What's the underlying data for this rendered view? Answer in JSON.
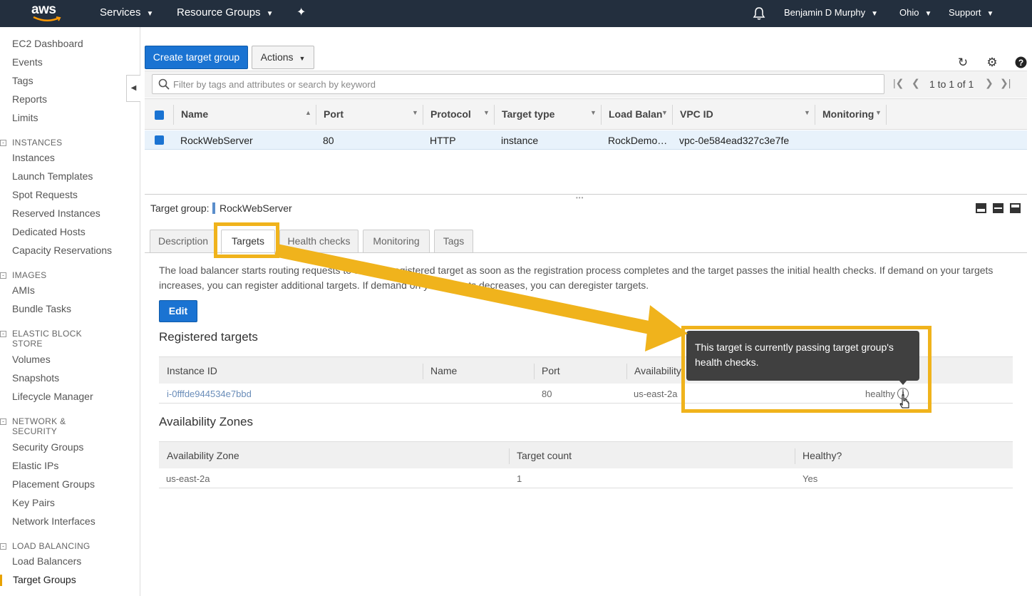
{
  "topbar": {
    "logo_text": "aws",
    "services": "Services",
    "resource_groups": "Resource Groups",
    "user": "Benjamin D Murphy",
    "region": "Ohio",
    "support": "Support"
  },
  "sidebar": {
    "top_links": [
      "EC2 Dashboard",
      "Events",
      "Tags",
      "Reports",
      "Limits"
    ],
    "sections": [
      {
        "title": "INSTANCES",
        "items": [
          "Instances",
          "Launch Templates",
          "Spot Requests",
          "Reserved Instances",
          "Dedicated Hosts",
          "Capacity Reservations"
        ]
      },
      {
        "title": "IMAGES",
        "items": [
          "AMIs",
          "Bundle Tasks"
        ]
      },
      {
        "title_line1": "ELASTIC BLOCK",
        "title_line2": "STORE",
        "items": [
          "Volumes",
          "Snapshots",
          "Lifecycle Manager"
        ]
      },
      {
        "title_line1": "NETWORK &",
        "title_line2": "SECURITY",
        "items": [
          "Security Groups",
          "Elastic IPs",
          "Placement Groups",
          "Key Pairs",
          "Network Interfaces"
        ]
      },
      {
        "title": "LOAD BALANCING",
        "items": [
          "Load Balancers",
          "Target Groups"
        ]
      }
    ],
    "active_item": "Target Groups"
  },
  "toolbar": {
    "create_label": "Create target group",
    "actions_label": "Actions",
    "search_placeholder": "Filter by tags and attributes or search by keyword",
    "pager_text": "1 to 1 of 1"
  },
  "grid": {
    "columns": [
      "Name",
      "Port",
      "Protocol",
      "Target type",
      "Load Balanc",
      "VPC ID",
      "Monitoring"
    ],
    "row": {
      "name": "RockWebServer",
      "port": "80",
      "protocol": "HTTP",
      "target_type": "instance",
      "load_balancer": "RockDemo…",
      "vpc_id": "vpc-0e584ead327c3e7fe",
      "monitoring": ""
    }
  },
  "detail": {
    "label": "Target group:",
    "name": "RockWebServer",
    "tabs": [
      "Description",
      "Targets",
      "Health checks",
      "Monitoring",
      "Tags"
    ],
    "active_tab": "Targets",
    "description": "The load balancer starts routing requests to a newly registered target as soon as the registration process completes and the target passes the initial health checks. If demand on your targets increases, you can register additional targets. If demand on your targets decreases, you can deregister targets.",
    "edit_label": "Edit",
    "registered_title": "Registered targets",
    "registered_columns": [
      "Instance ID",
      "Name",
      "Port",
      "Availability"
    ],
    "registered_row": {
      "instance_id": "i-0fffde944534e7bbd",
      "name": "",
      "port": "80",
      "zone": "us-east-2a",
      "status": "healthy"
    },
    "tooltip": "This target is currently passing target group's health checks.",
    "az_title": "Availability Zones",
    "az_columns": [
      "Availability Zone",
      "Target count",
      "Healthy?"
    ],
    "az_row": {
      "zone": "us-east-2a",
      "count": "1",
      "healthy": "Yes"
    }
  },
  "colors": {
    "accent": "#1a73d2",
    "highlight": "#f0b31c",
    "topbar": "#232f3e"
  }
}
